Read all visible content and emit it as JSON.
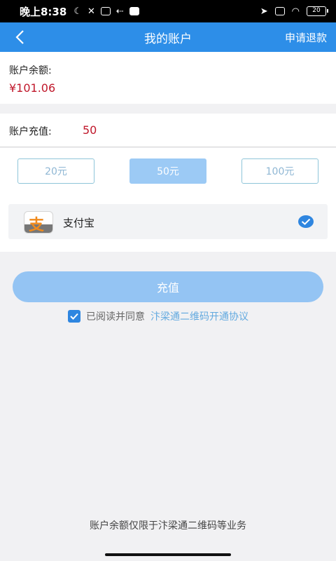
{
  "status_bar": {
    "time": "晚上8:38",
    "battery": "20"
  },
  "nav": {
    "title": "我的账户",
    "refund_label": "申请退款"
  },
  "balance": {
    "label": "账户余额:",
    "value": "¥101.06"
  },
  "recharge": {
    "label": "账户充值:",
    "amount": "50"
  },
  "amount_options": [
    {
      "label": "20元",
      "selected": false
    },
    {
      "label": "50元",
      "selected": true
    },
    {
      "label": "100元",
      "selected": false
    }
  ],
  "payment": {
    "method": "支付宝",
    "selected": true
  },
  "submit_label": "充值",
  "agreement": {
    "text": "已阅读并同意",
    "link": "汴梁通二维码开通协议",
    "checked": true
  },
  "footer_note": "账户余额仅限于汴梁通二维码等业务",
  "colors": {
    "primary": "#2d8ee8",
    "price": "#c0182b",
    "button_disabled": "#94c4f3"
  }
}
